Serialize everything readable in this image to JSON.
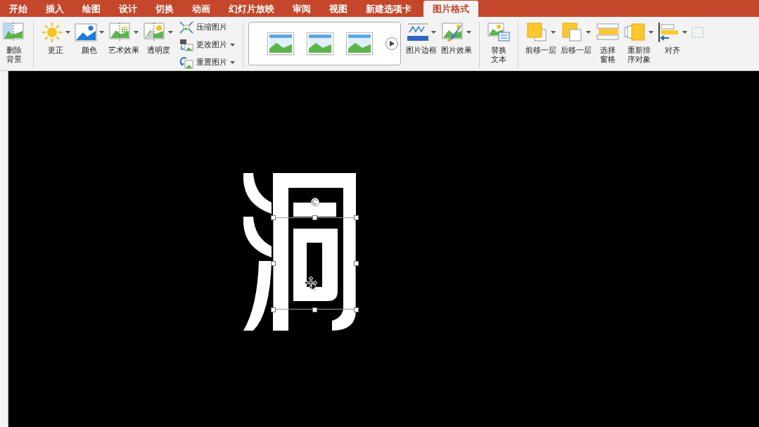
{
  "tabs": [
    {
      "label": "开始",
      "selected": false
    },
    {
      "label": "插入",
      "selected": false
    },
    {
      "label": "绘图",
      "selected": false
    },
    {
      "label": "设计",
      "selected": false
    },
    {
      "label": "切换",
      "selected": false
    },
    {
      "label": "动画",
      "selected": false
    },
    {
      "label": "幻灯片放映",
      "selected": false
    },
    {
      "label": "审阅",
      "selected": false
    },
    {
      "label": "视图",
      "selected": false
    },
    {
      "label": "新建选项卡",
      "selected": false
    },
    {
      "label": "图片格式",
      "selected": true
    }
  ],
  "ribbon": [
    {
      "kind": "tall",
      "label": "删除背景",
      "dropdown": false
    },
    {
      "kind": "separator"
    },
    {
      "kind": "large",
      "label": "更正",
      "dropdown": true
    },
    {
      "kind": "large",
      "label": "颜色",
      "dropdown": true
    },
    {
      "kind": "large",
      "label": "艺术效果",
      "dropdown": true
    },
    {
      "kind": "large",
      "label": "透明度",
      "dropdown": true
    },
    {
      "kind": "stack",
      "items": [
        {
          "label": "压缩图片",
          "dropdown": false
        },
        {
          "label": "更改图片",
          "dropdown": true
        },
        {
          "label": "重置图片",
          "dropdown": true
        }
      ]
    },
    {
      "kind": "separator"
    },
    {
      "kind": "gallery"
    },
    {
      "kind": "large",
      "label": "图片边框",
      "dropdown": true
    },
    {
      "kind": "large",
      "label": "图片效果",
      "dropdown": true
    },
    {
      "kind": "separator"
    },
    {
      "kind": "tall",
      "label": "替换文本",
      "dropdown": false
    },
    {
      "kind": "separator"
    },
    {
      "kind": "large",
      "label": "前移一层",
      "dropdown": true
    },
    {
      "kind": "large",
      "label": "后移一层",
      "dropdown": true
    },
    {
      "kind": "tall",
      "label": "选择窗格",
      "dropdown": false
    },
    {
      "kind": "tall",
      "label": "重新排序对象",
      "dropdown": true
    },
    {
      "kind": "large",
      "label": "对齐",
      "dropdown": true
    },
    {
      "kind": "icon"
    }
  ]
}
